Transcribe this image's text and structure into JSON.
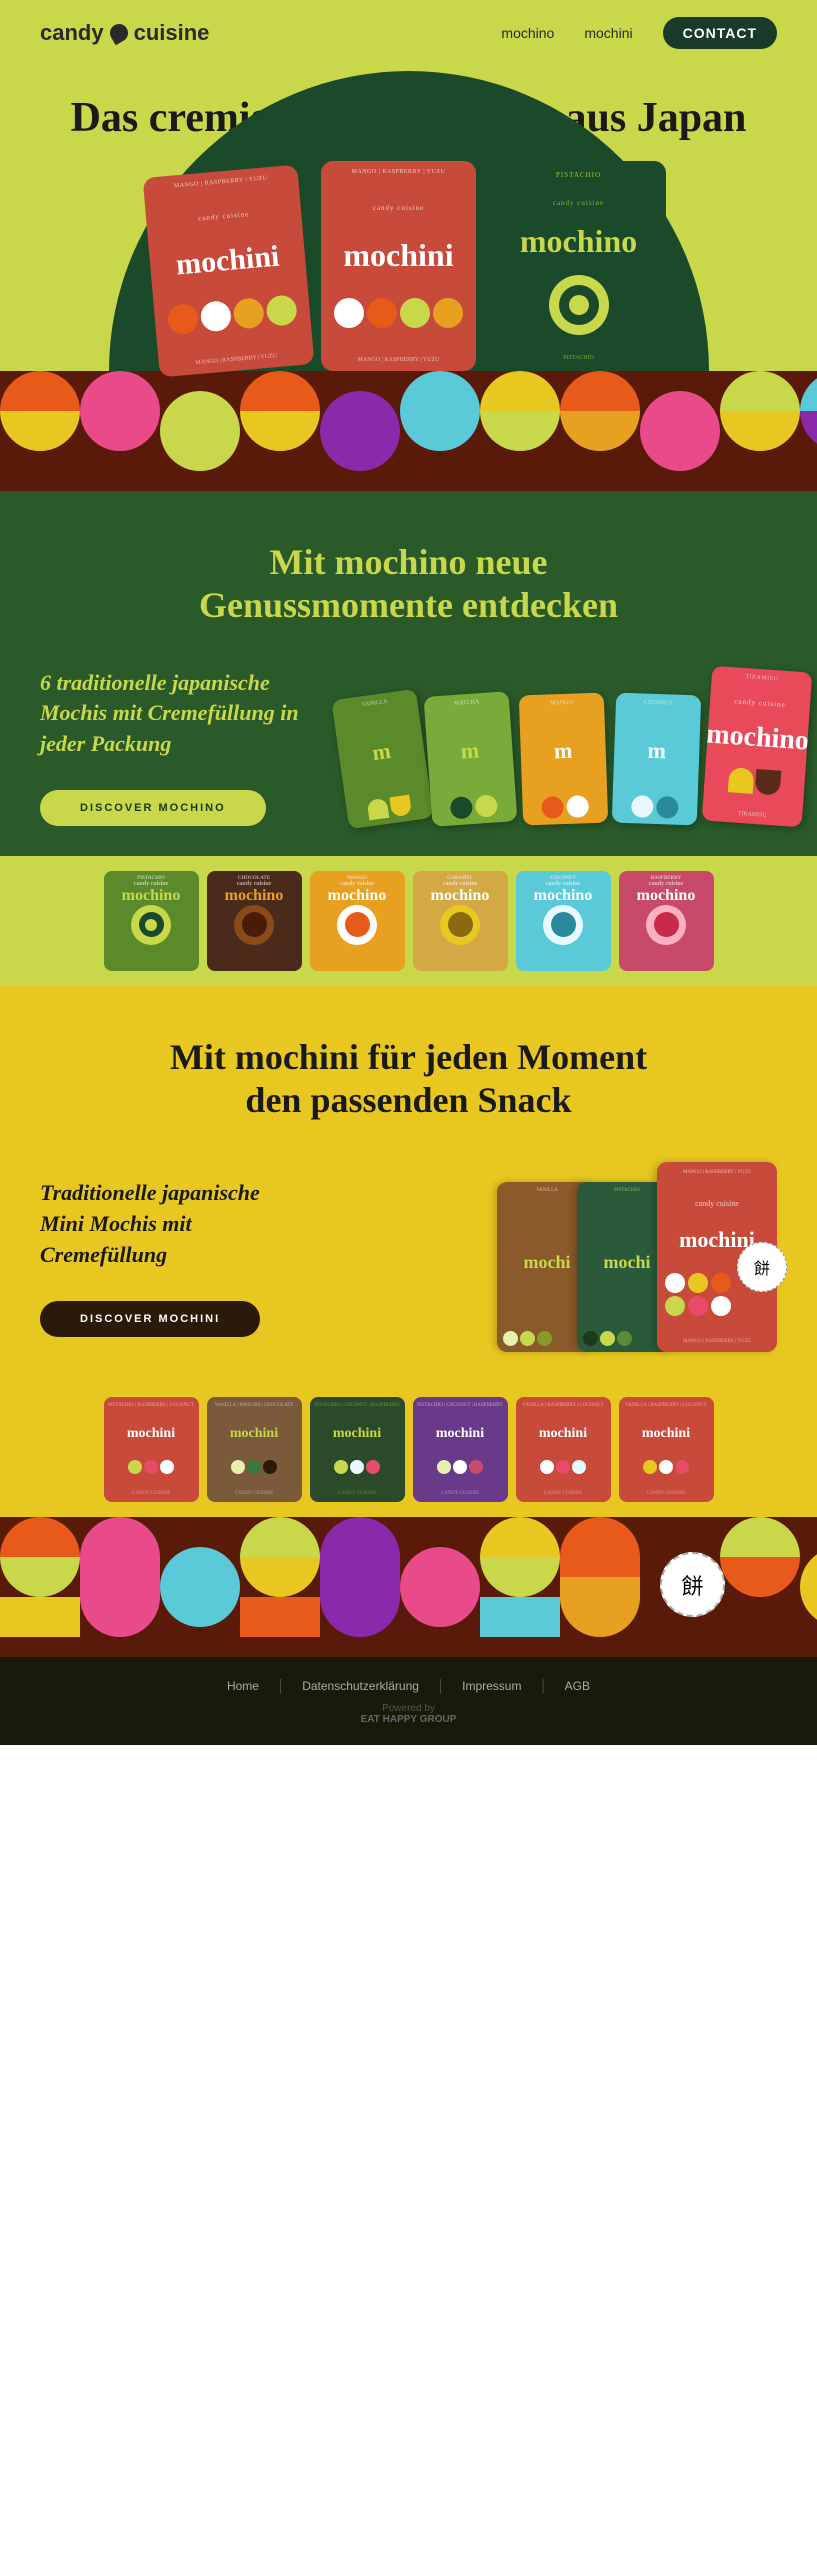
{
  "nav": {
    "logo": "candy cuisine",
    "links": [
      "mochino",
      "mochini"
    ],
    "contact": "CONTACT"
  },
  "hero": {
    "headline": "Das cremige Trend-Dessert  aus Japan",
    "products": {
      "bag1_label": "MANGO | RASPBERRY | YUZU",
      "bag1_brand": "candy cuisine",
      "bag1_name": "mochini",
      "bag2_label": "PISTACHIO",
      "bag2_brand": "candy cuisine",
      "bag2_name": "mochino"
    }
  },
  "mochino_section": {
    "headline": "Mit mochino neue\nGenussmomente entdecken",
    "body": "6 traditionelle japanische Mochis mit Cremefüllung in jeder Packung",
    "cta": "DISCOVER MOCHINO",
    "flavors": [
      "PISTACHIO",
      "CHOCOLATE",
      "MANGO",
      "CARAMEL",
      "COCONUT",
      "RASPBERRY"
    ]
  },
  "mochini_section": {
    "headline": "Mit mochini für jeden Moment\nden passenden Snack",
    "body": "Traditionelle japanische Mini Mochis mit Cremefüllung",
    "cta": "DISCOVER MOCHINI",
    "flavors": [
      "PISTACHIO | RASPBERRY | COCONUT",
      "VANILLA | MATCHA | CHOCOLATE",
      "PISTACHIO | COCONUT | RASPBERRY",
      "VANILLA | RASPBERRY | COCONUT",
      "PISTACHIO | COCONUT | RASPBERRY",
      "VANILLA | RASPBERRY | COCONUT"
    ]
  },
  "footer": {
    "links": [
      "Home",
      "Datenschutzerklärung",
      "Impressum",
      "AGB"
    ],
    "powered_by": "Powered by",
    "powered_name": "EAT HAPPY GROUP"
  }
}
